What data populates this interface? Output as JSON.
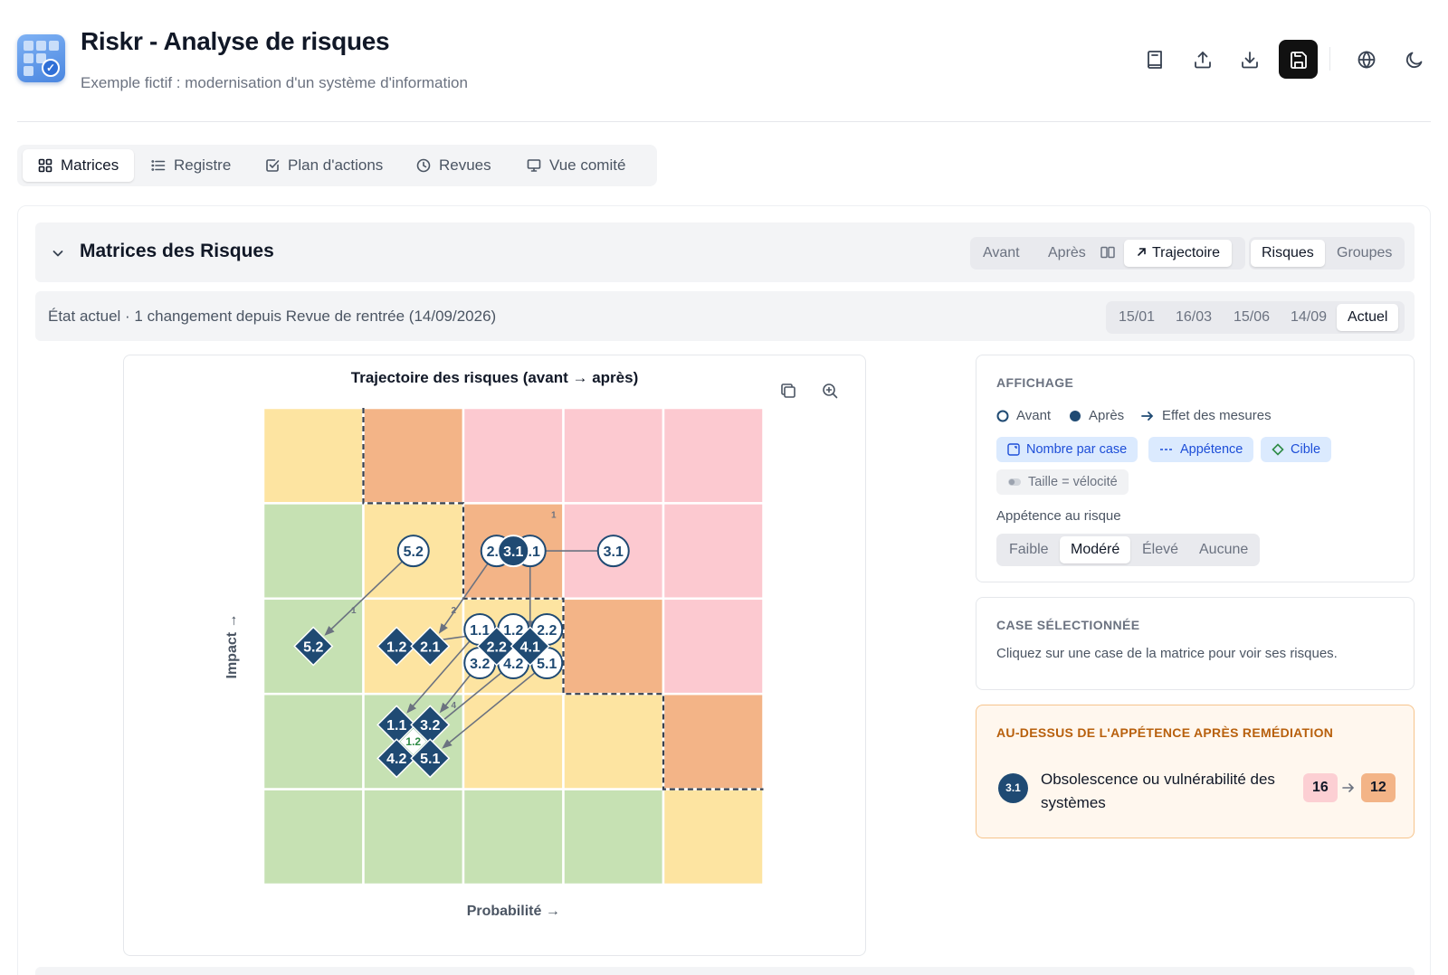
{
  "app": {
    "title": "Riskr - Analyse de risques",
    "subtitle": "Exemple fictif : modernisation d'un système d'information",
    "header_buttons": [
      "book-icon",
      "upload-icon",
      "download-icon",
      "save-icon",
      "globe-icon",
      "moon-icon"
    ]
  },
  "tabs": [
    {
      "label": "Matrices",
      "icon": "grid-icon",
      "active": true
    },
    {
      "label": "Registre",
      "icon": "list-icon"
    },
    {
      "label": "Plan d'actions",
      "icon": "checkbox-icon"
    },
    {
      "label": "Revues",
      "icon": "clock-icon"
    },
    {
      "label": "Vue comité",
      "icon": "monitor-icon"
    }
  ],
  "section": {
    "title": "Matrices des Risques",
    "view_modes": {
      "avant": "Avant",
      "apres": "Après",
      "compare_icon": "columns-icon",
      "trajectoire": "Trajectoire",
      "active": "Trajectoire"
    },
    "entity_modes": {
      "risques": "Risques",
      "groupes": "Groupes",
      "active": "Risques"
    }
  },
  "state": {
    "text": "État actuel · 1 changement depuis Revue de rentrée (14/09/2026)",
    "dates": [
      "15/01",
      "16/03",
      "15/06",
      "14/09",
      "Actuel"
    ],
    "active": "Actuel"
  },
  "chart": {
    "title": "Trajectoire des risques (avant → après)",
    "xlabel": "Probabilité →",
    "ylabel": "Impact →"
  },
  "chart_data": {
    "type": "heatmap",
    "title": "Trajectoire des risques (avant → après)",
    "xlabel": "Probabilité →",
    "ylabel": "Impact →",
    "grid_size": 5,
    "zone_colors": {
      "green": "#c6e1b3",
      "yellow": "#fde4a1",
      "orange": "#f3b487",
      "pink": "#fcc9d0"
    },
    "zones_top_to_bottom": [
      [
        "yellow",
        "orange",
        "pink",
        "pink",
        "pink"
      ],
      [
        "green",
        "yellow",
        "orange",
        "pink",
        "pink"
      ],
      [
        "green",
        "yellow",
        "yellow",
        "orange",
        "pink"
      ],
      [
        "green",
        "green",
        "yellow",
        "yellow",
        "orange"
      ],
      [
        "green",
        "green",
        "green",
        "green",
        "yellow"
      ]
    ],
    "cell_counts": [
      {
        "p": 3,
        "i": 4,
        "count": "1"
      },
      {
        "p": 1,
        "i": 3,
        "count": "1"
      },
      {
        "p": 2,
        "i": 3,
        "count": "2"
      },
      {
        "p": 2,
        "i": 2,
        "count": "4"
      }
    ],
    "before": [
      {
        "id": "5.2",
        "p": 2,
        "i": 4
      },
      {
        "id": "2.1",
        "p": 3,
        "i": 4
      },
      {
        "id": "4.1",
        "p": 3,
        "i": 4
      },
      {
        "id": "3.1",
        "p": 4,
        "i": 4
      },
      {
        "id": "1.1",
        "p": 3,
        "i": 3
      },
      {
        "id": "1.2",
        "p": 3,
        "i": 3
      },
      {
        "id": "2.2",
        "p": 3,
        "i": 3
      },
      {
        "id": "3.2",
        "p": 3,
        "i": 3
      },
      {
        "id": "4.2",
        "p": 3,
        "i": 3
      },
      {
        "id": "5.1",
        "p": 3,
        "i": 3
      }
    ],
    "after": [
      {
        "id": "3.1",
        "p": 3,
        "i": 4
      },
      {
        "id": "5.2",
        "p": 1,
        "i": 3
      },
      {
        "id": "1.2",
        "p": 2,
        "i": 3
      },
      {
        "id": "2.1",
        "p": 2,
        "i": 3
      },
      {
        "id": "2.2",
        "p": 3,
        "i": 3
      },
      {
        "id": "4.1",
        "p": 3,
        "i": 3
      },
      {
        "id": "1.1",
        "p": 2,
        "i": 2
      },
      {
        "id": "3.2",
        "p": 2,
        "i": 2
      },
      {
        "id": "4.2",
        "p": 2,
        "i": 2
      },
      {
        "id": "5.1",
        "p": 2,
        "i": 2
      }
    ],
    "targets": [
      {
        "id": "3.1",
        "p": 2,
        "i": 3
      },
      {
        "id": "4.1",
        "p": 2,
        "i": 3
      },
      {
        "id": "1.2",
        "p": 2,
        "i": 2
      }
    ]
  },
  "affichage": {
    "label": "AFFICHAGE",
    "legend": {
      "avant": "Avant",
      "apres": "Après",
      "effet": "Effet des mesures"
    },
    "chips": {
      "nombre": "Nombre par case",
      "appetence": "Appétence",
      "cible": "Cible",
      "taille": "Taille = vélocité"
    },
    "appetite_label": "Appétence au risque",
    "appetite_options": [
      "Faible",
      "Modéré",
      "Élevé",
      "Aucune"
    ],
    "appetite_active": "Modéré"
  },
  "selected_cell": {
    "label": "CASE SÉLECTIONNÉE",
    "hint": "Cliquez sur une case de la matrice pour voir ses risques."
  },
  "above_appetite": {
    "label": "AU-DESSUS DE L'APPÉTENCE APRÈS REMÉDIATION",
    "items": [
      {
        "id": "3.1",
        "name_line1": "Obsolescence ou vulnérabilité des",
        "name_line2": "systèmes",
        "before": "16",
        "after": "12"
      }
    ]
  },
  "colors": {
    "accent_navy": "#1f4a73",
    "target_green": "#2e8b45",
    "chip_blue_bg": "#dbeafe",
    "warn_bg": "#fff7ee",
    "warn_border": "#f6c48c",
    "badge_before": "#fccfd3",
    "badge_after": "#f3b487"
  }
}
